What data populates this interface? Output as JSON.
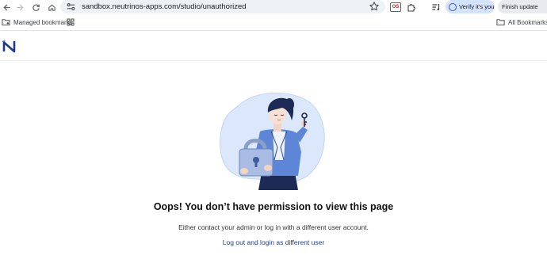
{
  "browser": {
    "url": "sandbox.neutrinos-apps.com/studio/unauthorized",
    "verify_label": "Verify it's you",
    "finish_update_label": "Finish update",
    "extension_badge": "OS",
    "colors": {
      "toolbar_bg": "#ffffff",
      "omnibox_bg": "#eef1f5",
      "verify_bg": "#d3e3fd"
    }
  },
  "bookmarks_bar": {
    "managed_label": "Managed bookmarks",
    "all_bookmarks_label": "All Bookmarks"
  },
  "app": {
    "logo_icon": "neutrinos-logo",
    "accent": "#1e3a8a"
  },
  "error_page": {
    "title": "Oops! You don’t have permission to view this page",
    "message": "Either contact your admin or log in with a different user account.",
    "logout_link": "Log out and login as different user",
    "illustration": "woman-with-padlock-and-key"
  }
}
